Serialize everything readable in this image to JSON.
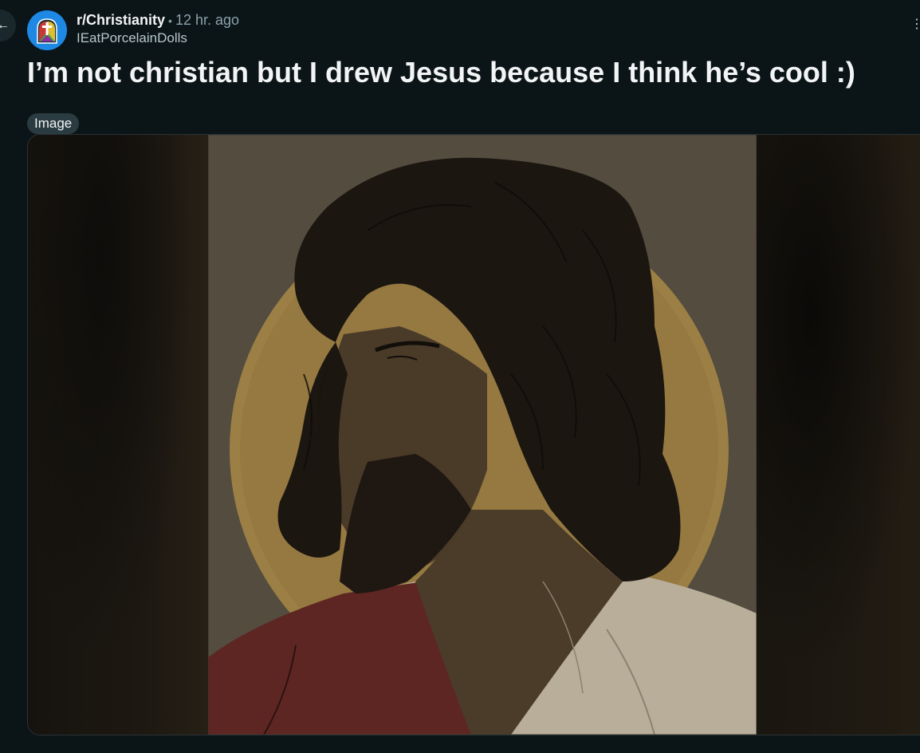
{
  "post": {
    "subreddit": "r/Christianity",
    "separator": "•",
    "time_ago": "12 hr. ago",
    "author": "IEatPorcelainDolls",
    "title": "I’m not christian but I drew Jesus because I think he’s cool :)",
    "flair": "Image"
  },
  "colors": {
    "background": "#0b1416",
    "subreddit_icon": "#1e88e5",
    "flair_background": "#2a3c42"
  },
  "icons": {
    "back": "arrow-left-icon",
    "subreddit": "stained-glass-cross-icon"
  }
}
